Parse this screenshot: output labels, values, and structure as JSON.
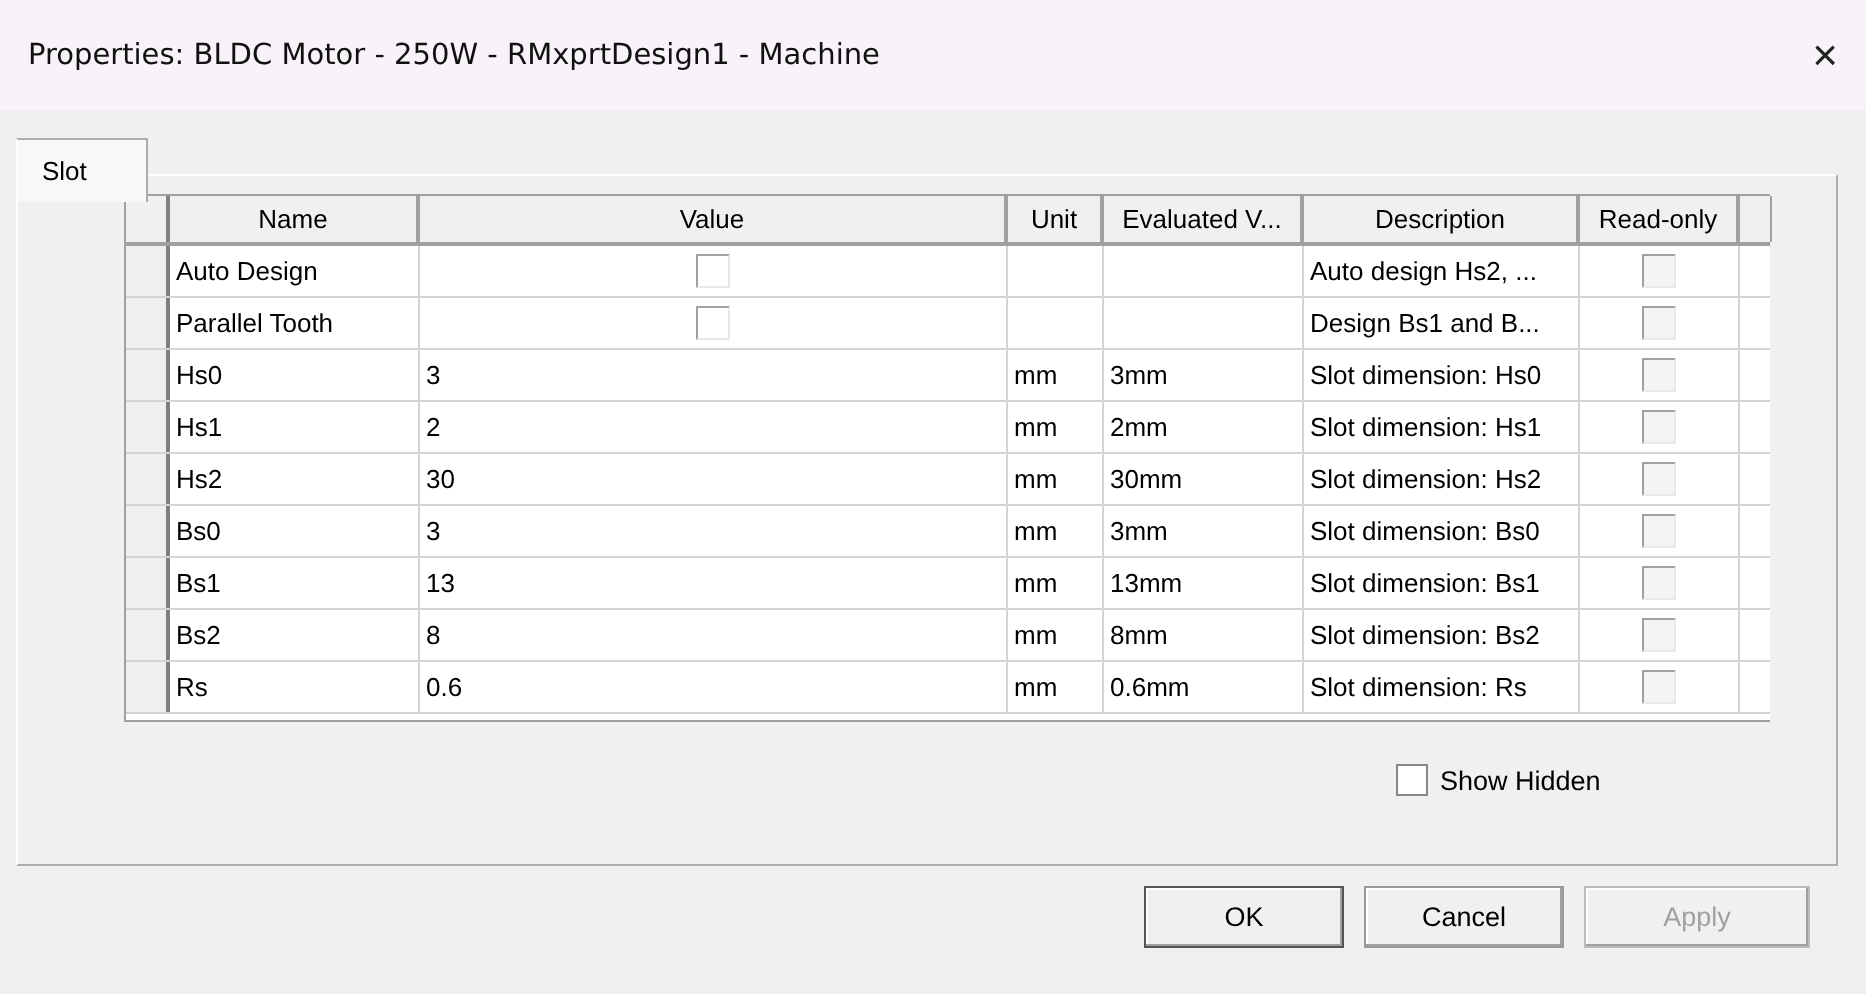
{
  "window": {
    "title": "Properties: BLDC Motor - 250W - RMxprtDesign1 - Machine",
    "close": "×"
  },
  "tabs": [
    {
      "label": "Slot",
      "selected": true
    }
  ],
  "table": {
    "columns": [
      "Name",
      "Value",
      "Unit",
      "Evaluated V...",
      "Description",
      "Read-only"
    ],
    "rows": [
      {
        "name": "Auto Design",
        "kind": "checkbox",
        "checked": false,
        "description": "Auto design Hs2, ...",
        "read_only": false
      },
      {
        "name": "Parallel Tooth",
        "kind": "checkbox",
        "checked": false,
        "description": "Design Bs1 and B...",
        "read_only": false
      },
      {
        "name": "Hs0",
        "kind": "text",
        "value": "3",
        "unit": "mm",
        "evaluated": "3mm",
        "description": "Slot dimension: Hs0",
        "read_only": false
      },
      {
        "name": "Hs1",
        "kind": "text",
        "value": "2",
        "unit": "mm",
        "evaluated": "2mm",
        "description": "Slot dimension: Hs1",
        "read_only": false
      },
      {
        "name": "Hs2",
        "kind": "text",
        "value": "30",
        "unit": "mm",
        "evaluated": "30mm",
        "description": "Slot dimension: Hs2",
        "read_only": false
      },
      {
        "name": "Bs0",
        "kind": "text",
        "value": "3",
        "unit": "mm",
        "evaluated": "3mm",
        "description": "Slot dimension: Bs0",
        "read_only": false
      },
      {
        "name": "Bs1",
        "kind": "text",
        "value": "13",
        "unit": "mm",
        "evaluated": "13mm",
        "description": "Slot dimension: Bs1",
        "read_only": false
      },
      {
        "name": "Bs2",
        "kind": "text",
        "value": "8",
        "unit": "mm",
        "evaluated": "8mm",
        "description": "Slot dimension: Bs2",
        "read_only": false
      },
      {
        "name": "Rs",
        "kind": "text",
        "value": "0.6",
        "unit": "mm",
        "evaluated": "0.6mm",
        "description": "Slot dimension: Rs",
        "read_only": false
      }
    ]
  },
  "show_hidden": {
    "label": "Show Hidden",
    "checked": false
  },
  "buttons": [
    {
      "label": "OK",
      "disabled": false
    },
    {
      "label": "Cancel",
      "disabled": false
    },
    {
      "label": "Apply",
      "disabled": true
    }
  ]
}
